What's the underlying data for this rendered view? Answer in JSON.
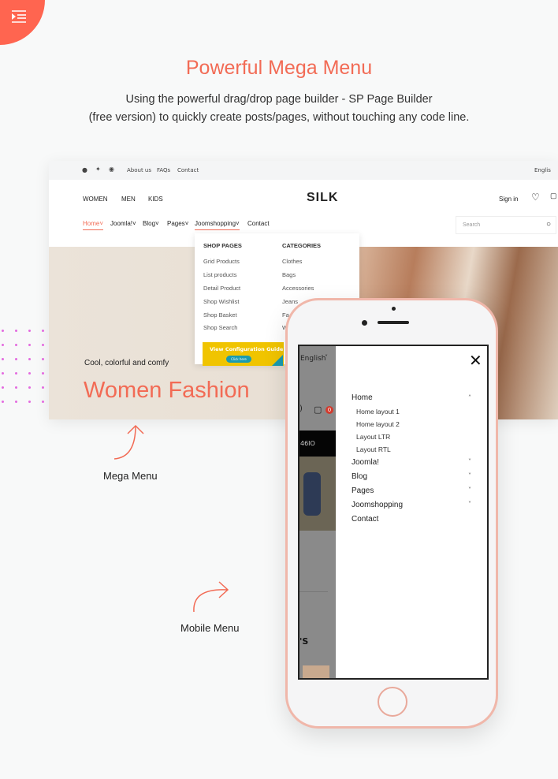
{
  "hero": {
    "title": "Powerful Mega Menu",
    "subtitle_line1": "Using the powerful drag/drop page builder  - SP Page Builder",
    "subtitle_line2": "(free version) to quickly create posts/pages, without touching any code line."
  },
  "colors": {
    "accent": "#f26b55",
    "corner": "#ff6550",
    "yellow": "#f0c400"
  },
  "corner_icon": "menu-indent-icon",
  "desktop": {
    "topbar": {
      "social": [
        "facebook-icon",
        "twitter-icon",
        "pinterest-icon"
      ],
      "links": [
        "About us",
        "FAQs",
        "Contact"
      ],
      "language": "Englis"
    },
    "category_nav": [
      "WOMEN",
      "MEN",
      "KIDS"
    ],
    "logo": "SILK",
    "sign_in": "Sign in",
    "main_nav": [
      "Home",
      "Joomla!",
      "Blog",
      "Pages",
      "Joomshopping",
      "Contact"
    ],
    "search_placeholder": "Search",
    "mega_menu": {
      "col1_title": "SHOP PAGES",
      "col1": [
        "Grid Products",
        "List products",
        "Detail Product",
        "Shop Wishlist",
        "Shop Basket",
        "Shop Search"
      ],
      "col2_title": "CATEGORIES",
      "col2": [
        "Clothes",
        "Bags",
        "Accessories",
        "Jeans",
        "Fa",
        "W"
      ],
      "banner_title": "View Configuration Guide",
      "banner_button": "Click here"
    },
    "tagline": "Cool, colorful and comfy",
    "headline": "Women Fashion"
  },
  "labels": {
    "mega": "Mega Menu",
    "mobile": "Mobile Menu"
  },
  "mobile": {
    "language": "English",
    "cart_count": "0",
    "promo_fragment": "46IO",
    "heading_fragment": "'S",
    "menu": [
      {
        "label": "Home",
        "expanded": true,
        "children": [
          "Home layout 1",
          "Home layout 2",
          "Layout LTR",
          "Layout RTL"
        ]
      },
      {
        "label": "Joomla!"
      },
      {
        "label": "Blog"
      },
      {
        "label": "Pages"
      },
      {
        "label": "Joomshopping"
      },
      {
        "label": "Contact"
      }
    ]
  }
}
